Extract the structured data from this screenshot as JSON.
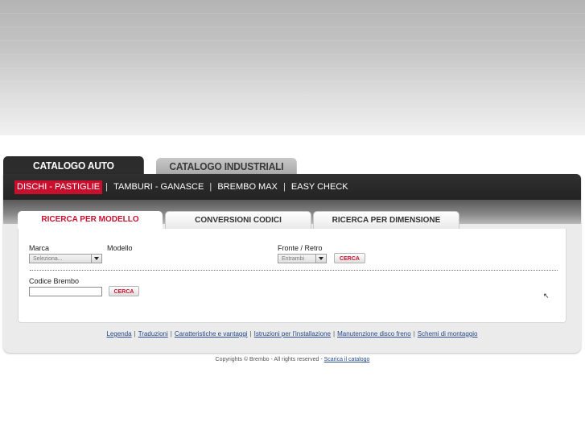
{
  "catalog_tabs": [
    {
      "label": "CATALOGO AUTO",
      "active": true
    },
    {
      "label": "CATALOGO INDUSTRIALI",
      "active": false
    }
  ],
  "subnav": {
    "items": [
      "DISCHI - PASTIGLIE",
      "TAMBURI - GANASCE",
      "BREMBO MAX",
      "EASY CHECK"
    ],
    "separator": "|"
  },
  "search_tabs": [
    "RICERCA PER MODELLO",
    "CONVERSIONI CODICI",
    "RICERCA PER DIMENSIONE"
  ],
  "form": {
    "marca_label": "Marca",
    "marca_value": "Seleziona...",
    "modello_label": "Modello",
    "fronte_label": "Fronte / Retro",
    "fronte_value": "Entrambi",
    "cerca_label": "CERCA",
    "codice_label": "Codice Brembo",
    "codice_value": ""
  },
  "links": [
    "Legenda",
    "Traduzioni",
    "Caratteristiche e vantaggi",
    "Istruzioni per l'installazione",
    "Manutenzione disco freno",
    "Schemi di montaggio"
  ],
  "footer": {
    "copyright": "Copyrights © Brembo - All rights reserved - ",
    "download_link": "Scarica il catalogo"
  },
  "colors": {
    "accent": "#c8102e",
    "dark_bar": "#2c2c2c",
    "link": "#274a8c"
  }
}
